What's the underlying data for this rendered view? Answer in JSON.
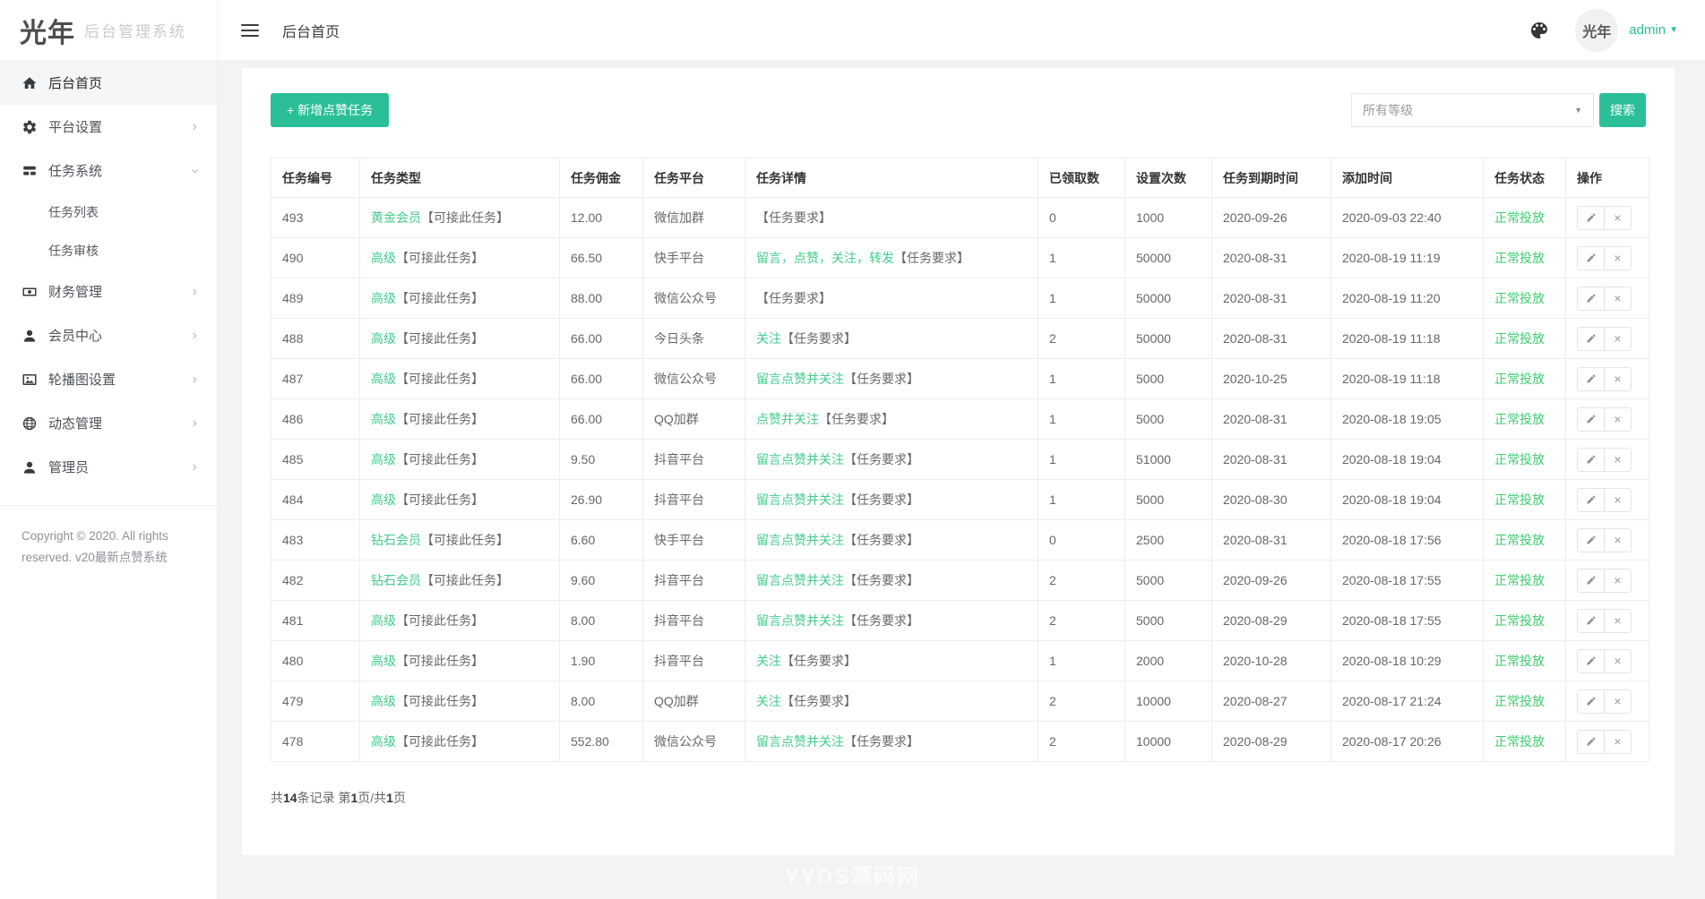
{
  "colors": {
    "accent": "#2bbf99",
    "link_green": "#42cc8c",
    "status_green": "#3ecd6d"
  },
  "app": {
    "logo_mark": "光年",
    "logo_text": "后台管理系统",
    "page_title": "后台首页",
    "username": "admin"
  },
  "sidebar": {
    "items": [
      {
        "name": "home",
        "icon": "home-icon",
        "label": "后台首页",
        "active": true,
        "chevron": null
      },
      {
        "name": "platform-settings",
        "icon": "gear-icon",
        "label": "平台设置",
        "chevron": "right"
      },
      {
        "name": "task-system",
        "icon": "tasks-icon",
        "label": "任务系统",
        "chevron": "down",
        "children": [
          {
            "name": "task-list",
            "label": "任务列表"
          },
          {
            "name": "task-review",
            "label": "任务审核"
          }
        ]
      },
      {
        "name": "finance",
        "icon": "finance-icon",
        "label": "财务管理",
        "chevron": "right"
      },
      {
        "name": "member-center",
        "icon": "member-icon",
        "label": "会员中心",
        "chevron": "right"
      },
      {
        "name": "carousel-settings",
        "icon": "image-icon",
        "label": "轮播图设置",
        "chevron": "right"
      },
      {
        "name": "dynamic-management",
        "icon": "globe-icon",
        "label": "动态管理",
        "chevron": "right"
      },
      {
        "name": "administrator",
        "icon": "admin-user-icon",
        "label": "管理员",
        "chevron": "right"
      }
    ],
    "copyright": "Copyright © 2020. All rights reserved. v20最新点赞系统"
  },
  "toolbar": {
    "add_button": "+ 新增点赞任务",
    "level_filter": "所有等级",
    "search_button": "搜索"
  },
  "table": {
    "headers": [
      "任务编号",
      "任务类型",
      "任务佣金",
      "任务平台",
      "任务详情",
      "已领取数",
      "设置次数",
      "任务到期时间",
      "添加时间",
      "任务状态",
      "操作"
    ],
    "rows": [
      {
        "id": "493",
        "type_hl": "黄金会员",
        "type": "【可接此任务】",
        "commission": "12.00",
        "platform": "微信加群",
        "detail_hl": "",
        "detail": "【任务要求】",
        "claimed": "0",
        "times": "1000",
        "expire": "2020-09-26",
        "added": "2020-09-03 22:40",
        "status": "正常投放"
      },
      {
        "id": "490",
        "type_hl": "高级",
        "type": "【可接此任务】",
        "commission": "66.50",
        "platform": "快手平台",
        "detail_hl": "留言，点赞，关注，转发",
        "detail": "【任务要求】",
        "claimed": "1",
        "times": "50000",
        "expire": "2020-08-31",
        "added": "2020-08-19 11:19",
        "status": "正常投放"
      },
      {
        "id": "489",
        "type_hl": "高级",
        "type": "【可接此任务】",
        "commission": "88.00",
        "platform": "微信公众号",
        "detail_hl": "",
        "detail": "【任务要求】",
        "claimed": "1",
        "times": "50000",
        "expire": "2020-08-31",
        "added": "2020-08-19 11:20",
        "status": "正常投放"
      },
      {
        "id": "488",
        "type_hl": "高级",
        "type": "【可接此任务】",
        "commission": "66.00",
        "platform": "今日头条",
        "detail_hl": "关注",
        "detail": "【任务要求】",
        "claimed": "2",
        "times": "50000",
        "expire": "2020-08-31",
        "added": "2020-08-19 11:18",
        "status": "正常投放"
      },
      {
        "id": "487",
        "type_hl": "高级",
        "type": "【可接此任务】",
        "commission": "66.00",
        "platform": "微信公众号",
        "detail_hl": "留言点赞并关注",
        "detail": "【任务要求】",
        "claimed": "1",
        "times": "5000",
        "expire": "2020-10-25",
        "added": "2020-08-19 11:18",
        "status": "正常投放"
      },
      {
        "id": "486",
        "type_hl": "高级",
        "type": "【可接此任务】",
        "commission": "66.00",
        "platform": "QQ加群",
        "detail_hl": "点赞并关注",
        "detail": "【任务要求】",
        "claimed": "1",
        "times": "5000",
        "expire": "2020-08-31",
        "added": "2020-08-18 19:05",
        "status": "正常投放"
      },
      {
        "id": "485",
        "type_hl": "高级",
        "type": "【可接此任务】",
        "commission": "9.50",
        "platform": "抖音平台",
        "detail_hl": "留言点赞并关注",
        "detail": "【任务要求】",
        "claimed": "1",
        "times": "51000",
        "expire": "2020-08-31",
        "added": "2020-08-18 19:04",
        "status": "正常投放"
      },
      {
        "id": "484",
        "type_hl": "高级",
        "type": "【可接此任务】",
        "commission": "26.90",
        "platform": "抖音平台",
        "detail_hl": "留言点赞并关注",
        "detail": "【任务要求】",
        "claimed": "1",
        "times": "5000",
        "expire": "2020-08-30",
        "added": "2020-08-18 19:04",
        "status": "正常投放"
      },
      {
        "id": "483",
        "type_hl": "钻石会员",
        "type": "【可接此任务】",
        "commission": "6.60",
        "platform": "快手平台",
        "detail_hl": "留言点赞并关注",
        "detail": "【任务要求】",
        "claimed": "0",
        "times": "2500",
        "expire": "2020-08-31",
        "added": "2020-08-18 17:56",
        "status": "正常投放"
      },
      {
        "id": "482",
        "type_hl": "钻石会员",
        "type": "【可接此任务】",
        "commission": "9.60",
        "platform": "抖音平台",
        "detail_hl": "留言点赞并关注",
        "detail": "【任务要求】",
        "claimed": "2",
        "times": "5000",
        "expire": "2020-09-26",
        "added": "2020-08-18 17:55",
        "status": "正常投放"
      },
      {
        "id": "481",
        "type_hl": "高级",
        "type": "【可接此任务】",
        "commission": "8.00",
        "platform": "抖音平台",
        "detail_hl": "留言点赞并关注",
        "detail": "【任务要求】",
        "claimed": "2",
        "times": "5000",
        "expire": "2020-08-29",
        "added": "2020-08-18 17:55",
        "status": "正常投放"
      },
      {
        "id": "480",
        "type_hl": "高级",
        "type": "【可接此任务】",
        "commission": "1.90",
        "platform": "抖音平台",
        "detail_hl": "关注",
        "detail": "【任务要求】",
        "claimed": "1",
        "times": "2000",
        "expire": "2020-10-28",
        "added": "2020-08-18 10:29",
        "status": "正常投放"
      },
      {
        "id": "479",
        "type_hl": "高级",
        "type": "【可接此任务】",
        "commission": "8.00",
        "platform": "QQ加群",
        "detail_hl": "关注",
        "detail": "【任务要求】",
        "claimed": "2",
        "times": "10000",
        "expire": "2020-08-27",
        "added": "2020-08-17 21:24",
        "status": "正常投放"
      },
      {
        "id": "478",
        "type_hl": "高级",
        "type": "【可接此任务】",
        "commission": "552.80",
        "platform": "微信公众号",
        "detail_hl": "留言点赞并关注",
        "detail": "【任务要求】",
        "claimed": "2",
        "times": "10000",
        "expire": "2020-08-29",
        "added": "2020-08-17 20:26",
        "status": "正常投放"
      }
    ]
  },
  "pagination": {
    "parts": [
      "共",
      "14",
      "条记录 第",
      "1",
      "页/共",
      "1",
      "页"
    ]
  },
  "watermark": "YYDS源码网"
}
